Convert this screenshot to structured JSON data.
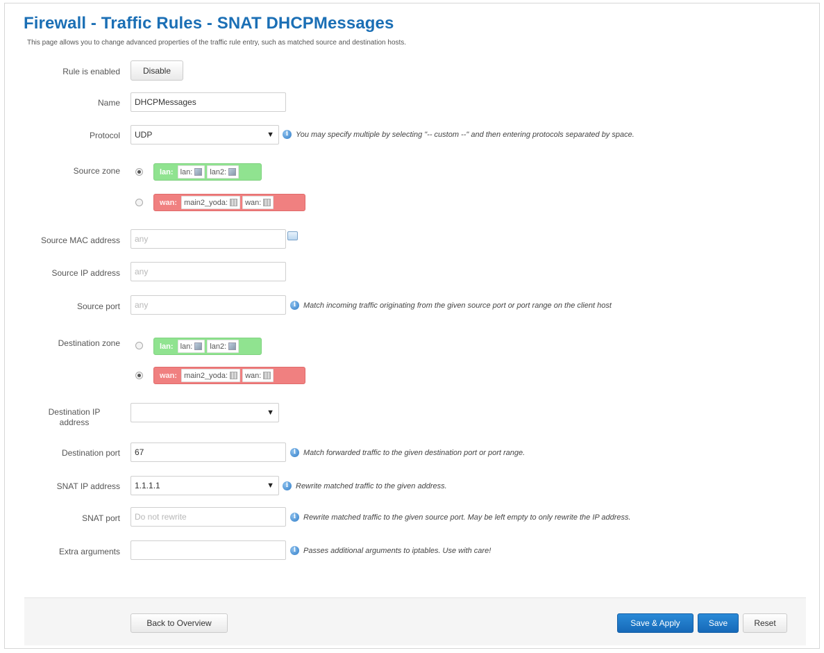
{
  "header": {
    "title": "Firewall - Traffic Rules - SNAT DHCPMessages",
    "description": "This page allows you to change advanced properties of the traffic rule entry, such as matched source and destination hosts."
  },
  "rule_enabled": {
    "label": "Rule is enabled",
    "button": "Disable"
  },
  "name": {
    "label": "Name",
    "value": "DHCPMessages"
  },
  "protocol": {
    "label": "Protocol",
    "value": "UDP",
    "help": "You may specify multiple by selecting \"-- custom --\" and then entering protocols separated by space."
  },
  "source_zone": {
    "label": "Source zone",
    "selected": "lan",
    "zones": [
      {
        "name": "lan:",
        "color": "#90e390",
        "ifaces": [
          "lan:",
          "lan2:"
        ]
      },
      {
        "name": "wan:",
        "color": "#f08080",
        "ifaces": [
          "main2_yoda:",
          "wan:"
        ]
      }
    ]
  },
  "source_mac": {
    "label": "Source MAC address",
    "placeholder": "any"
  },
  "source_ip": {
    "label": "Source IP address",
    "placeholder": "any"
  },
  "source_port": {
    "label": "Source port",
    "placeholder": "any",
    "help": "Match incoming traffic originating from the given source port or port range on the client host"
  },
  "destination_zone": {
    "label": "Destination zone",
    "selected": "wan",
    "zones": [
      {
        "name": "lan:",
        "color": "#90e390",
        "ifaces": [
          "lan:",
          "lan2:"
        ]
      },
      {
        "name": "wan:",
        "color": "#f08080",
        "ifaces": [
          "main2_yoda:",
          "wan:"
        ]
      }
    ]
  },
  "destination_ip": {
    "label": "Destination IP address",
    "value": ""
  },
  "destination_port": {
    "label": "Destination port",
    "value": "67",
    "help": "Match forwarded traffic to the given destination port or port range."
  },
  "snat_ip": {
    "label": "SNAT IP address",
    "value": "1.1.1.1",
    "help": "Rewrite matched traffic to the given address."
  },
  "snat_port": {
    "label": "SNAT port",
    "placeholder": "Do not rewrite",
    "help": "Rewrite matched traffic to the given source port. May be left empty to only rewrite the IP address."
  },
  "extra_args": {
    "label": "Extra arguments",
    "value": "",
    "help": "Passes additional arguments to iptables. Use with care!"
  },
  "footer": {
    "back_label": "Back to Overview",
    "save_apply_label": "Save & Apply",
    "save_label": "Save",
    "reset_label": "Reset"
  },
  "colors": {
    "accent": "#1b6fb5",
    "primary_button": "#1669b8",
    "zone_lan": "#90e390",
    "zone_wan": "#f08080"
  },
  "icons": [
    "info-icon",
    "dropdown-caret-icon",
    "interface-icon",
    "mac-list-icon"
  ]
}
